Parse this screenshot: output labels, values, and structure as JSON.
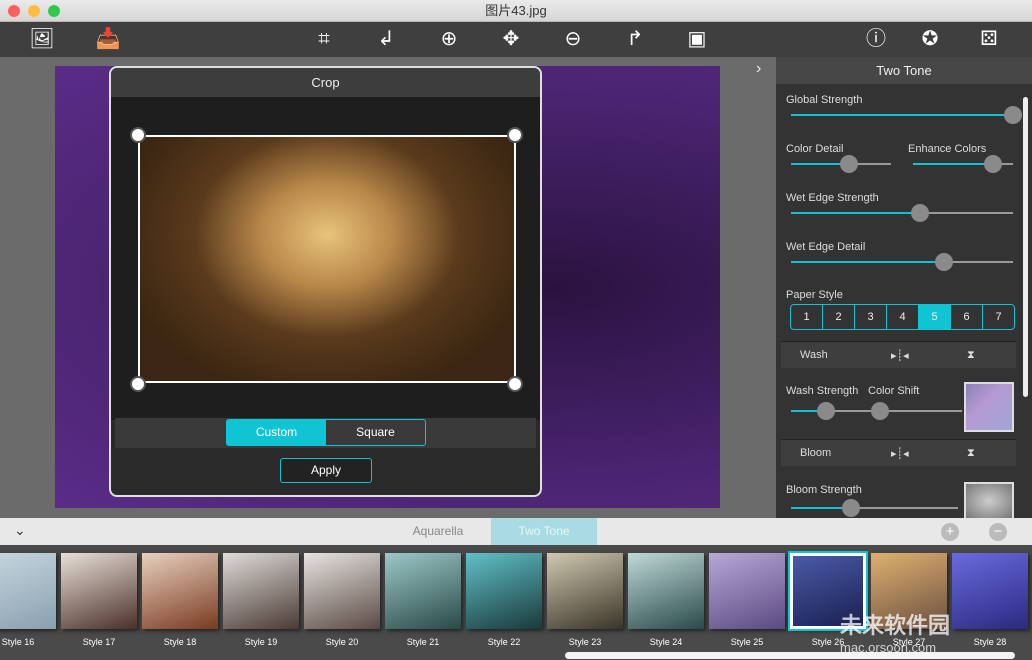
{
  "window": {
    "title": "图片43.jpg"
  },
  "toolbar": {
    "left": [
      "photo-icon",
      "export-icon"
    ],
    "center": [
      "crop-icon",
      "rotate-left-icon",
      "zoom-in-icon",
      "move-icon",
      "zoom-out-icon",
      "rotate-right-icon",
      "fit-image-icon"
    ],
    "right": [
      "info-icon",
      "settings-icon",
      "random-dice-icon"
    ]
  },
  "crop": {
    "title": "Crop",
    "modes": [
      "Custom",
      "Square"
    ],
    "selected_mode": "Custom",
    "apply_label": "Apply"
  },
  "panel": {
    "title": "Two Tone",
    "global_strength": {
      "label": "Global Strength",
      "value": 100
    },
    "color_detail": {
      "label": "Color Detail",
      "value": 58
    },
    "enhance_colors": {
      "label": "Enhance Colors",
      "value": 80
    },
    "wet_edge_strength": {
      "label": "Wet Edge Strength",
      "value": 58
    },
    "wet_edge_detail": {
      "label": "Wet Edge Detail",
      "value": 69
    },
    "paper_style": {
      "label": "Paper Style",
      "options": [
        "1",
        "2",
        "3",
        "4",
        "5",
        "6",
        "7"
      ],
      "selected": "5"
    },
    "wash": {
      "label": "Wash"
    },
    "wash_strength": {
      "label": "Wash Strength",
      "value": 44
    },
    "color_shift": {
      "label": "Color Shift",
      "value": 5
    },
    "bloom": {
      "label": "Bloom"
    },
    "bloom_strength": {
      "label": "Bloom Strength",
      "value": 36
    }
  },
  "tabs": [
    {
      "label": "Aquarella",
      "active": false
    },
    {
      "label": "Two Tone",
      "active": true
    }
  ],
  "styles": [
    "Style 16",
    "Style 17",
    "Style 18",
    "Style 19",
    "Style 20",
    "Style 21",
    "Style 22",
    "Style 23",
    "Style 24",
    "Style 25",
    "Style 26",
    "Style 27",
    "Style 28"
  ],
  "selected_style": "Style 26",
  "watermark": "未来软件园 mac.orsoon.com",
  "colors": {
    "accent": "#11c4d4"
  }
}
